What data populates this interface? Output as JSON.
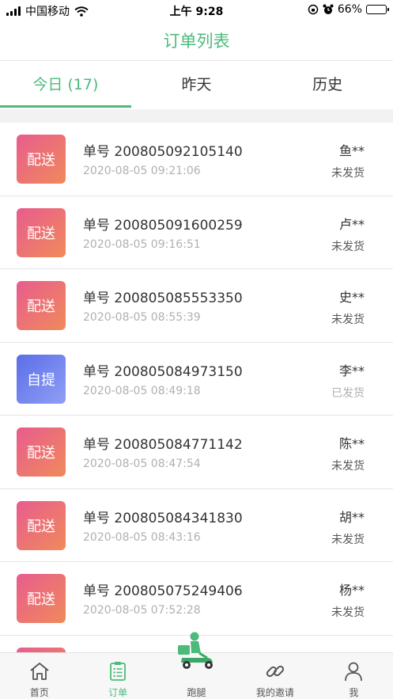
{
  "status_bar": {
    "carrier": "中国移动",
    "time": "上午 9:28",
    "battery": "66%",
    "battery_level": 0.66
  },
  "header": {
    "title": "订单列表"
  },
  "tabs": [
    {
      "label": "今日 (17)",
      "active": true
    },
    {
      "label": "昨天",
      "active": false
    },
    {
      "label": "历史",
      "active": false
    }
  ],
  "orders": [
    {
      "type": "配送",
      "order_no": "单号 200805092105140",
      "time": "2020-08-05 09:21:06",
      "customer": "鱼**",
      "status": "未发货"
    },
    {
      "type": "配送",
      "order_no": "单号 200805091600259",
      "time": "2020-08-05 09:16:51",
      "customer": "卢**",
      "status": "未发货"
    },
    {
      "type": "配送",
      "order_no": "单号 200805085553350",
      "time": "2020-08-05 08:55:39",
      "customer": "史**",
      "status": "未发货"
    },
    {
      "type": "自提",
      "order_no": "单号 200805084973150",
      "time": "2020-08-05 08:49:18",
      "customer": "李**",
      "status": "已发货"
    },
    {
      "type": "配送",
      "order_no": "单号 200805084771142",
      "time": "2020-08-05 08:47:54",
      "customer": "陈**",
      "status": "未发货"
    },
    {
      "type": "配送",
      "order_no": "单号 200805084341830",
      "time": "2020-08-05 08:43:16",
      "customer": "胡**",
      "status": "未发货"
    },
    {
      "type": "配送",
      "order_no": "单号 200805075249406",
      "time": "2020-08-05 07:52:28",
      "customer": "杨**",
      "status": "未发货"
    }
  ],
  "tabbar": {
    "items": [
      {
        "label": "首页",
        "icon": "home-icon"
      },
      {
        "label": "订单",
        "icon": "order-list-icon",
        "active": true
      },
      {
        "label": "跑腿",
        "icon": "delivery-rider-icon"
      },
      {
        "label": "我的邀请",
        "icon": "link-icon"
      },
      {
        "label": "我",
        "icon": "user-icon"
      }
    ]
  },
  "colors": {
    "accent": "#4cbb7a",
    "delivery_badge": [
      "#e85c8e",
      "#f08a5a"
    ],
    "pickup_badge": [
      "#5b6ee8",
      "#8f9ff5"
    ]
  }
}
